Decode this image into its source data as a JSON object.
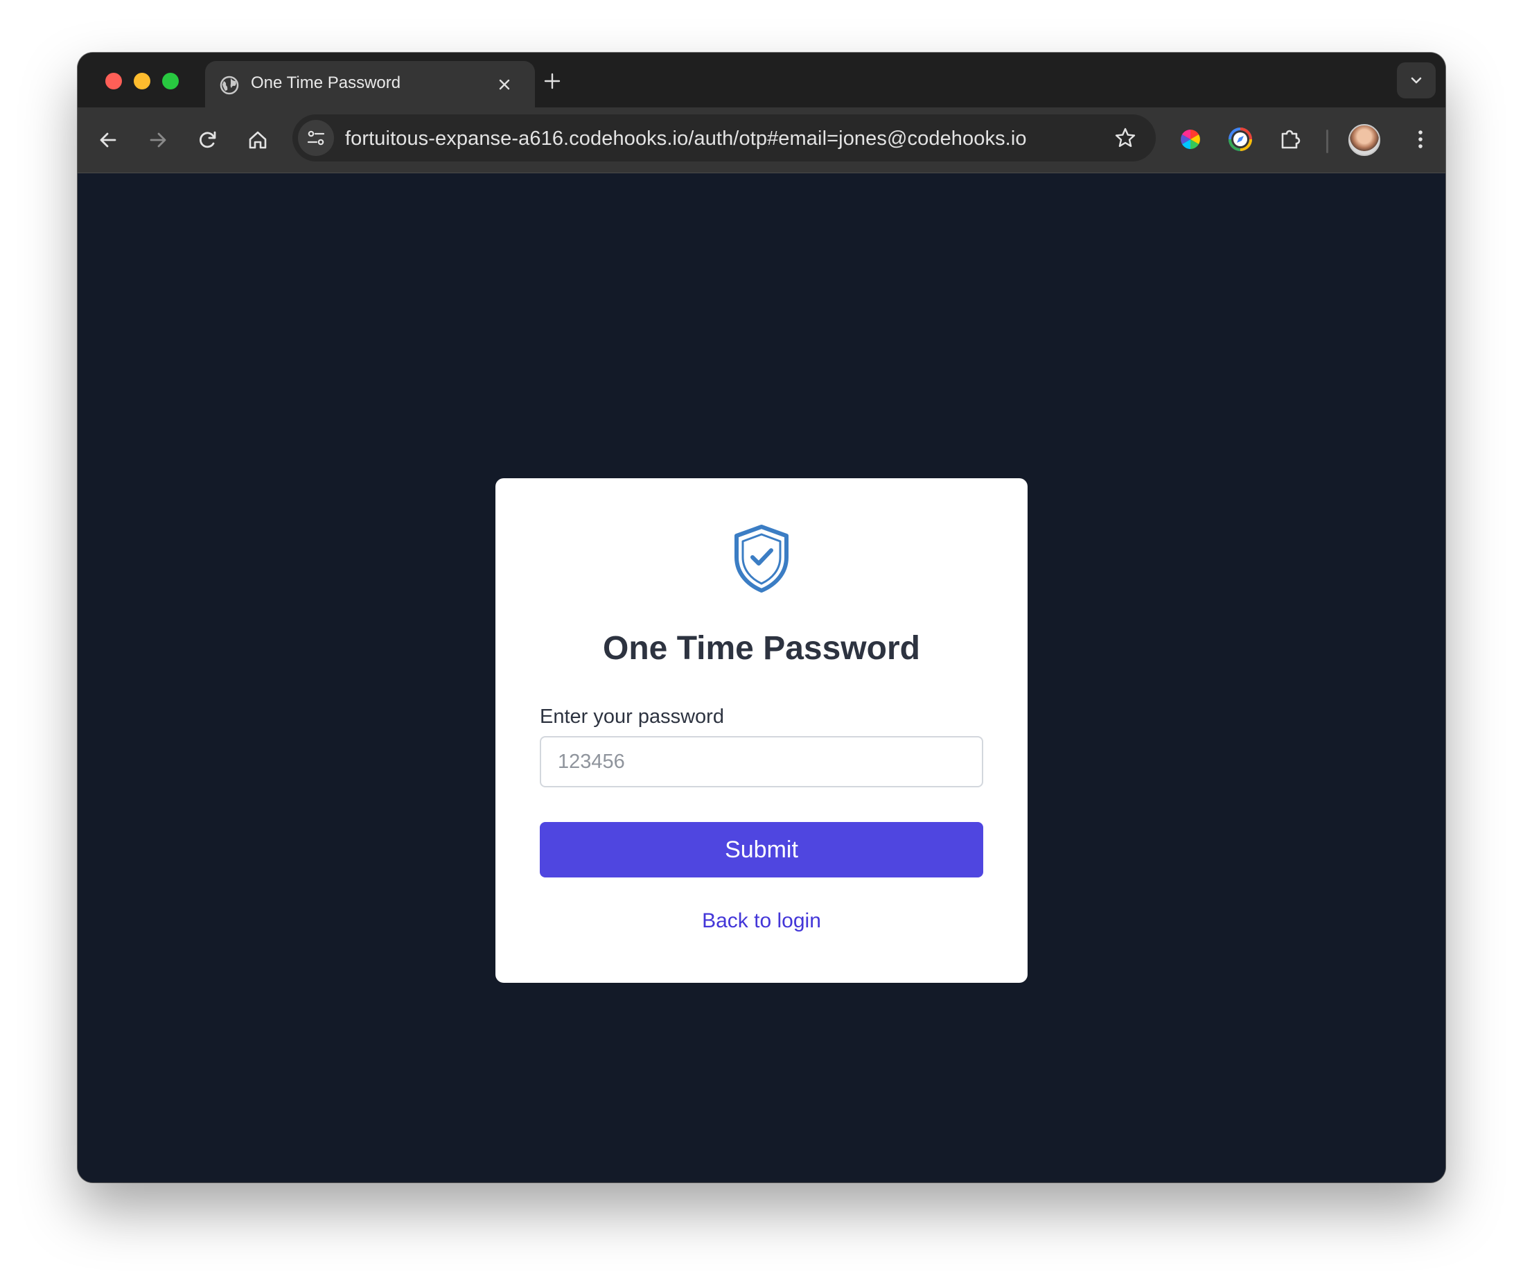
{
  "browser": {
    "tab": {
      "title": "One Time Password",
      "icon": "globe-icon"
    },
    "address_bar": {
      "url": "fortuitous-expanse-a616.codehooks.io/auth/otp#email=jones@codehooks.io"
    }
  },
  "page": {
    "icon": "shield-check-icon",
    "title": "One Time Password",
    "field_label": "Enter your password",
    "input": {
      "value": "",
      "placeholder": "123456"
    },
    "submit_label": "Submit",
    "back_link": "Back to login"
  },
  "colors": {
    "page_background": "#131a28",
    "button": "#4f46e0",
    "link": "#4336d8",
    "shield": "#3b7dc4"
  }
}
